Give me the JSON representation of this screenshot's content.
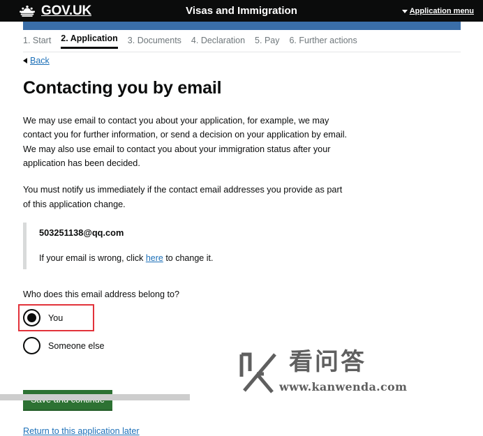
{
  "header": {
    "crown_icon": "crown-icon",
    "brand": "GOV.UK",
    "service_name": "Visas and Immigration",
    "app_menu_label": "Application menu",
    "caret_icon": "caret-down-icon",
    "background": "#0b0c0c",
    "progress_bar_color": "#3a6ea8"
  },
  "steps": [
    {
      "label": "1. Start",
      "active": false
    },
    {
      "label": "2. Application",
      "active": true
    },
    {
      "label": "3. Documents",
      "active": false
    },
    {
      "label": "4. Declaration",
      "active": false
    },
    {
      "label": "5. Pay",
      "active": false
    },
    {
      "label": "6. Further actions",
      "active": false
    }
  ],
  "back": {
    "icon": "back-arrow-icon",
    "label": "Back"
  },
  "main": {
    "title": "Contacting you by email",
    "paragraph_1": "We may use email to contact you about your application, for example, we may contact you for further information, or send a decision on your application by email. We may also use email to contact you about your immigration status after your application has been decided.",
    "paragraph_2": "You must notify us immediately if the contact email addresses you provide as part of this application change.",
    "email_value": "503251138@qq.com",
    "email_hint_before": "If your email is wrong, click ",
    "email_hint_link": "here",
    "email_hint_after": " to change it.",
    "question": "Who does this email address belong to?",
    "radios": [
      {
        "label": "You",
        "selected": true
      },
      {
        "label": "Someone else",
        "selected": false
      }
    ],
    "save_label": "Save and continue",
    "return_label": "Return to this application later"
  },
  "annotation": {
    "color": "#e2323a",
    "target": "You"
  },
  "watermark": {
    "chinese": "看问答",
    "url": "www.kanwenda.com",
    "logo_icon": "k-logo-icon"
  },
  "colors": {
    "link": "#1d70b8",
    "button_green": "#2d7233",
    "inset_border": "#d8dada",
    "muted_text": "#6f777b"
  }
}
